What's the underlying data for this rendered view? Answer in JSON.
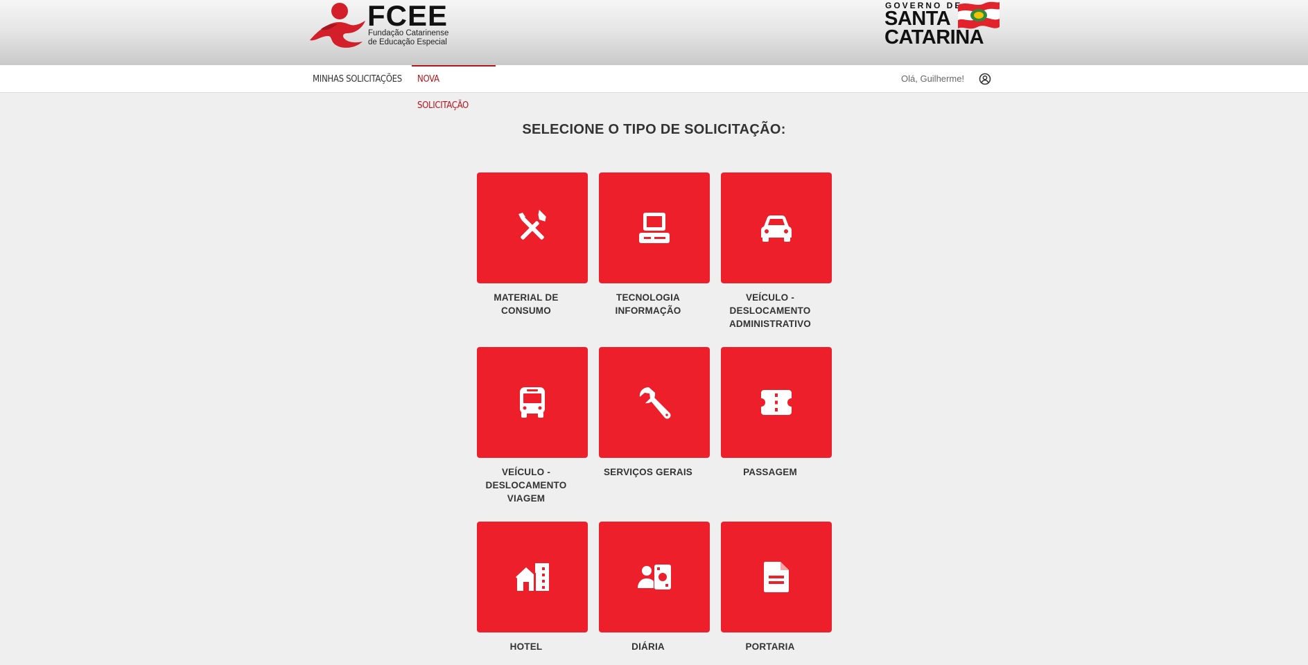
{
  "header": {
    "fcee_title": "FCEE",
    "fcee_subtitle_line1": "Fundação Catarinense",
    "fcee_subtitle_line2": "de Educação Especial",
    "gov_line1": "GOVERNO DE",
    "gov_line2": "SANTA",
    "gov_line3": "CATARINA",
    "brand_color": "#ec1f2a"
  },
  "nav": {
    "items": [
      {
        "label": "MINHAS SOLICITAÇÕES",
        "active": false
      },
      {
        "label": "NOVA SOLICITAÇÃO",
        "active": true
      }
    ],
    "greeting": "Olá, Guilherme!",
    "user_icon": "user-circle-icon",
    "active_color": "#b3151d"
  },
  "main": {
    "title": "SELECIONE O TIPO DE SOLICITAÇÃO:",
    "tiles": [
      {
        "label_lines": [
          "MATERIAL DE",
          "CONSUMO"
        ],
        "icon": "tools-icon"
      },
      {
        "label_lines": [
          "TECNOLOGIA",
          "INFORMAÇÃO"
        ],
        "icon": "computer-icon"
      },
      {
        "label_lines": [
          "VEÍCULO -",
          "DESLOCAMENTO",
          "ADMINISTRATIVO"
        ],
        "icon": "car-icon"
      },
      {
        "label_lines": [
          "VEÍCULO -",
          "DESLOCAMENTO",
          "VIAGEM"
        ],
        "icon": "bus-icon"
      },
      {
        "label_lines": [
          "SERVIÇOS GERAIS"
        ],
        "icon": "wrench-icon"
      },
      {
        "label_lines": [
          "PASSAGEM"
        ],
        "icon": "ticket-icon"
      },
      {
        "label_lines": [
          "HOTEL"
        ],
        "icon": "hotel-icon"
      },
      {
        "label_lines": [
          "DIÁRIA"
        ],
        "icon": "money-user-icon"
      },
      {
        "label_lines": [
          "PORTARIA"
        ],
        "icon": "document-icon"
      }
    ]
  }
}
